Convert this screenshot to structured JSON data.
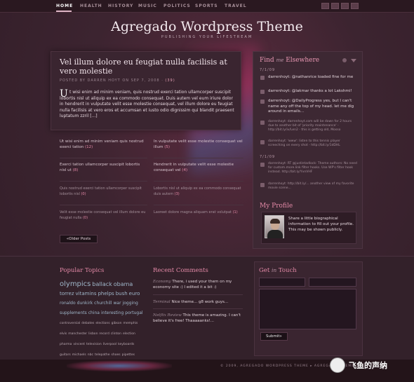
{
  "nav": {
    "items": [
      "HOME",
      "HEALTH",
      "HISTORY",
      "MUSIC",
      "POLITICS",
      "SPORTS",
      "TRAVEL"
    ],
    "active": "HOME"
  },
  "header": {
    "title": "Agregado Wordpress Theme",
    "tagline": "PUBLISHING YOUR LIFESTREAM"
  },
  "featured": {
    "title": "Vel illum dolore eu feugiat nulla facilisis at vero molestie",
    "meta": "POSTED BY DARREN HOYT ON SEP 7, 2008 ·",
    "comments": "(39)",
    "dropcap": "U",
    "body_line1": "t wisi enim ad minim veniam, quis nostrud exerci tation ullamcorper suscipit",
    "body_rest": "lobortis nisl ut aliquip ex ea commodo consequat. Duis autem vel eum iriure dolor in hendrerit in vulputate velit esse molestie consequat, vel illum dolore eu feugiat nulla facilisis at vero eros et accumsan et iusto odio dignissim qui blandit praesent luptatum zzril [...]"
  },
  "excerpts": [
    {
      "text": "Ut wisi enim ad minim veniam quis nostrud exerci tation",
      "count": "(12)"
    },
    {
      "text": "In vulputate velit esse molestie consequat vel illum",
      "count": "(5)"
    },
    {
      "text": "Exerci tation ullamcorper suscipit lobortis nisl ut",
      "count": "(8)"
    },
    {
      "text": "Hendrerit in vulputate velit esse molestie consequat vel",
      "count": "(4)"
    },
    {
      "text": "Quis nostrud exerci tation ullamcorper suscipit lobortis nisl",
      "count": "(0)"
    },
    {
      "text": "Lobortis nisl ut aliquip ex ea commodo consequat duis autem",
      "count": "(3)"
    },
    {
      "text": "Velit esse molestie consequat vel illum dolore eu feugiat nulla",
      "count": "(0)"
    },
    {
      "text": "Laoreet dolore magna aliquam erat volutpat",
      "count": "(1)"
    }
  ],
  "older_posts": "«Older Posts",
  "sidebar": {
    "elsewhere_title": "Find",
    "elsewhere_me": "me",
    "elsewhere_rest": "Elsewhere",
    "date1": "7/1/09",
    "date2": "7/1/09",
    "tweets": [
      "darrenhoyt: @nathanrice loaded fine for me",
      "darrenhoyt: @lakmar thanks a lot Lakshmi!",
      "darrenhoyt: @DailyProgress yes, but I can't name any off the top of my head. let me dig around in emails...",
      "darrenhoyt: darrenhoyt.com will be down for 2 hours due to another bit of 'priority maintenance' - http://bit.ly/iv/Len2 - this is getting old, Mosso",
      "darrenhoyt: 'www': listen to this tennis player screeching on every shot - http://bit.ly/1dDHL",
      "darrenhoyt: RT @justintadlock: Theme authors: No need for custom.more.link filter hooks. Use WP's filter hook instead. http://bit.ly/YvnVHF",
      "darrenhoyt: http://bit.ly/... another view of my favorite movie scene..."
    ],
    "profile_title": "My Profile",
    "profile_text": "Share a little biographical information to fill out your profile. This may be shown publicly."
  },
  "footer": {
    "popular_title": "Popular Topics",
    "tags": [
      {
        "t": "olympics",
        "s": 10
      },
      {
        "t": "ballack",
        "s": 8
      },
      {
        "t": "obama",
        "s": 8
      },
      {
        "t": "torrez",
        "s": 7
      },
      {
        "t": "vitamins",
        "s": 7
      },
      {
        "t": "phelps",
        "s": 7
      },
      {
        "t": "bush",
        "s": 7
      },
      {
        "t": "euro",
        "s": 7
      },
      {
        "t": "ronaldo",
        "s": 6
      },
      {
        "t": "dunkirk",
        "s": 6
      },
      {
        "t": "churchill",
        "s": 6
      },
      {
        "t": "war",
        "s": 6
      },
      {
        "t": "jogging",
        "s": 6
      },
      {
        "t": "supplements",
        "s": 6
      },
      {
        "t": "china",
        "s": 6
      },
      {
        "t": "interesting",
        "s": 6
      },
      {
        "t": "portugal",
        "s": 6
      },
      {
        "t": "controversial",
        "s": 4.5
      },
      {
        "t": "debates",
        "s": 4.5
      },
      {
        "t": "elections",
        "s": 4.5
      },
      {
        "t": "gibson",
        "s": 4.5
      },
      {
        "t": "memphis",
        "s": 4.5
      },
      {
        "t": "elvis",
        "s": 4.5
      },
      {
        "t": "manchester",
        "s": 4.5
      },
      {
        "t": "lisbon",
        "s": 4.5
      },
      {
        "t": "record",
        "s": 4.5
      },
      {
        "t": "clinton",
        "s": 4.5
      },
      {
        "t": "election",
        "s": 4.5
      },
      {
        "t": "pharma",
        "s": 4.5
      },
      {
        "t": "vincent",
        "s": 4.5
      },
      {
        "t": "television",
        "s": 4.5
      },
      {
        "t": "liverpool",
        "s": 4.5
      },
      {
        "t": "keyboards",
        "s": 4.5
      },
      {
        "t": "guitars",
        "s": 4.5
      },
      {
        "t": "michaels",
        "s": 4.5
      },
      {
        "t": "nbc",
        "s": 4.5
      },
      {
        "t": "telepathe",
        "s": 4.5
      },
      {
        "t": "shoes",
        "s": 4.5
      },
      {
        "t": "pipettes",
        "s": 4.5
      }
    ],
    "recent_title": "Recent Comments",
    "comments": [
      {
        "who": "Economy",
        "text": "There, i used your them on my economy site :) I edited it a bit :)"
      },
      {
        "who": "Terminal",
        "text": "Nice theme... g8 work guys..."
      },
      {
        "who": "Netflix Review",
        "text": "This theme is amazing. I can't believe it's free! Thaaaaanks!..."
      }
    ],
    "contact_title": "Get",
    "contact_in": "in",
    "contact_rest": "Touch",
    "submit": "Submit»",
    "copyright": "© 2009, AGREGADO WORDPRESS THEME ▸ AGREGADO THEME"
  },
  "watermark": "飞鱼的声纳"
}
